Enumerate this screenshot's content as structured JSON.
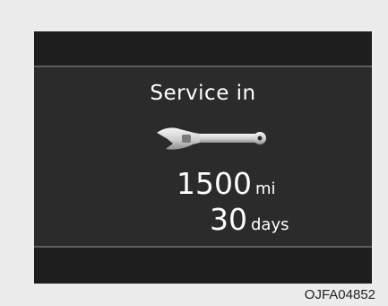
{
  "display": {
    "title": "Service in",
    "icon": "wrench-icon",
    "distance_value": "1500",
    "distance_unit": "mi",
    "time_value": "30",
    "time_unit": "days"
  },
  "caption": "OJFA04852"
}
